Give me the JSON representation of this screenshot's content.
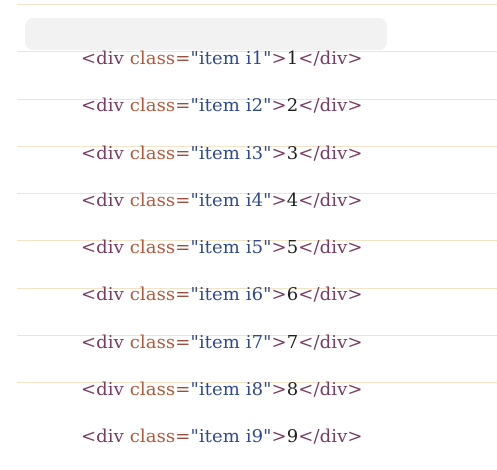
{
  "code_list": {
    "lines": [
      {
        "open_tag": "<div",
        "attr_name": "class",
        "equals": "=",
        "attr_value": "\"item i1\"",
        "tag_close": ">",
        "content": "1",
        "closing_tag": "</div>",
        "highlighted": true
      },
      {
        "open_tag": "<div",
        "attr_name": "class",
        "equals": "=",
        "attr_value": "\"item i2\"",
        "tag_close": ">",
        "content": "2",
        "closing_tag": "</div>",
        "highlighted": false
      },
      {
        "open_tag": "<div",
        "attr_name": "class",
        "equals": "=",
        "attr_value": "\"item i3\"",
        "tag_close": ">",
        "content": "3",
        "closing_tag": "</div>",
        "highlighted": false
      },
      {
        "open_tag": "<div",
        "attr_name": "class",
        "equals": "=",
        "attr_value": "\"item i4\"",
        "tag_close": ">",
        "content": "4",
        "closing_tag": "</div>",
        "highlighted": false
      },
      {
        "open_tag": "<div",
        "attr_name": "class",
        "equals": "=",
        "attr_value": "\"item i5\"",
        "tag_close": ">",
        "content": "5",
        "closing_tag": "</div>",
        "highlighted": false
      },
      {
        "open_tag": "<div",
        "attr_name": "class",
        "equals": "=",
        "attr_value": "\"item i6\"",
        "tag_close": ">",
        "content": "6",
        "closing_tag": "</div>",
        "highlighted": false
      },
      {
        "open_tag": "<div",
        "attr_name": "class",
        "equals": "=",
        "attr_value": "\"item i7\"",
        "tag_close": ">",
        "content": "7",
        "closing_tag": "</div>",
        "highlighted": false
      },
      {
        "open_tag": "<div",
        "attr_name": "class",
        "equals": "=",
        "attr_value": "\"item i8\"",
        "tag_close": ">",
        "content": "8",
        "closing_tag": "</div>",
        "highlighted": false
      },
      {
        "open_tag": "<div",
        "attr_name": "class",
        "equals": "=",
        "attr_value": "\"item i9\"",
        "tag_close": ">",
        "content": "9",
        "closing_tag": "</div>",
        "highlighted": false
      }
    ]
  },
  "colors": {
    "tag": "#7a3b62",
    "attr_name": "#b4573b",
    "attr_value": "#2f4a8f",
    "content": "#1f1f1f",
    "highlight": "#f2f2f2",
    "divider": "#f3e3c7"
  }
}
